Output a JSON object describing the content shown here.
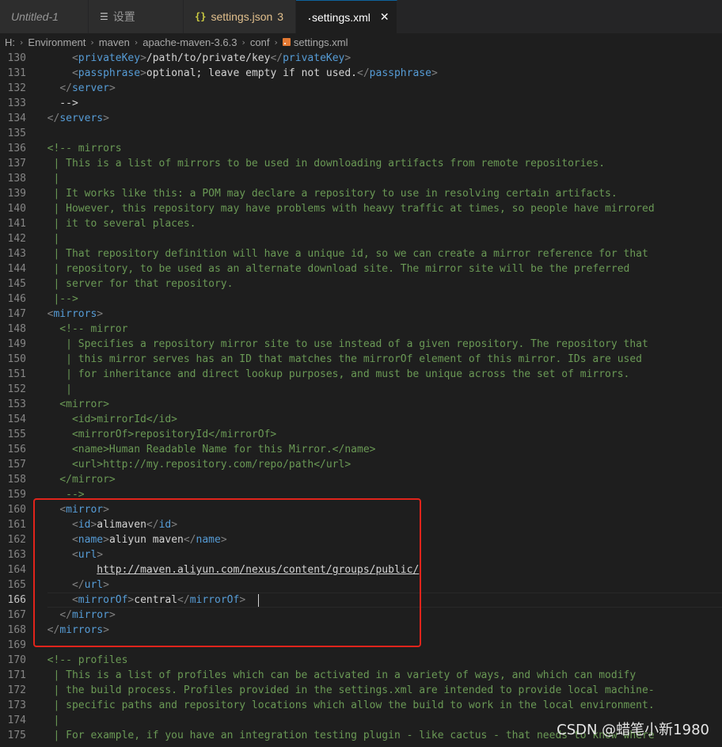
{
  "tabs": [
    {
      "label": "Untitled-1",
      "icon": "file-icon"
    },
    {
      "label": "设置",
      "icon": "settings-icon"
    },
    {
      "label": "settings.json",
      "badge": "3",
      "icon": "json-icon"
    },
    {
      "label": "settings.xml",
      "icon": "rss-icon",
      "active": true
    }
  ],
  "breadcrumb": [
    "H:",
    "Environment",
    "maven",
    "apache-maven-3.6.3",
    "conf",
    "settings.xml"
  ],
  "colors": {
    "highlight_box": "#e0241b",
    "active_tab_border": "#0e639c",
    "comment": "#6a9955",
    "tag": "#569cd6"
  },
  "editor": {
    "current_line": 166,
    "lines": [
      {
        "n": 130,
        "text": "      <privateKey>/path/to/private/key</privateKey>"
      },
      {
        "n": 131,
        "text": "      <passphrase>optional; leave empty if not used.</passphrase>"
      },
      {
        "n": 132,
        "text": "    </server>"
      },
      {
        "n": 133,
        "text": "    -->"
      },
      {
        "n": 134,
        "text": "  </servers>"
      },
      {
        "n": 135,
        "text": ""
      },
      {
        "n": 136,
        "text": "  <!-- mirrors"
      },
      {
        "n": 137,
        "text": "   | This is a list of mirrors to be used in downloading artifacts from remote repositories."
      },
      {
        "n": 138,
        "text": "   |"
      },
      {
        "n": 139,
        "text": "   | It works like this: a POM may declare a repository to use in resolving certain artifacts."
      },
      {
        "n": 140,
        "text": "   | However, this repository may have problems with heavy traffic at times, so people have mirrored"
      },
      {
        "n": 141,
        "text": "   | it to several places."
      },
      {
        "n": 142,
        "text": "   |"
      },
      {
        "n": 143,
        "text": "   | That repository definition will have a unique id, so we can create a mirror reference for that"
      },
      {
        "n": 144,
        "text": "   | repository, to be used as an alternate download site. The mirror site will be the preferred"
      },
      {
        "n": 145,
        "text": "   | server for that repository."
      },
      {
        "n": 146,
        "text": "   |-->"
      },
      {
        "n": 147,
        "text": "  <mirrors>"
      },
      {
        "n": 148,
        "text": "    <!-- mirror"
      },
      {
        "n": 149,
        "text": "     | Specifies a repository mirror site to use instead of a given repository. The repository that"
      },
      {
        "n": 150,
        "text": "     | this mirror serves has an ID that matches the mirrorOf element of this mirror. IDs are used"
      },
      {
        "n": 151,
        "text": "     | for inheritance and direct lookup purposes, and must be unique across the set of mirrors."
      },
      {
        "n": 152,
        "text": "     |"
      },
      {
        "n": 153,
        "text": "    <mirror>"
      },
      {
        "n": 154,
        "text": "      <id>mirrorId</id>"
      },
      {
        "n": 155,
        "text": "      <mirrorOf>repositoryId</mirrorOf>"
      },
      {
        "n": 156,
        "text": "      <name>Human Readable Name for this Mirror.</name>"
      },
      {
        "n": 157,
        "text": "      <url>http://my.repository.com/repo/path</url>"
      },
      {
        "n": 158,
        "text": "    </mirror>"
      },
      {
        "n": 159,
        "text": "     -->"
      },
      {
        "n": 160,
        "text": "    <mirror>"
      },
      {
        "n": 161,
        "text": "      <id>alimaven</id>"
      },
      {
        "n": 162,
        "text": "      <name>aliyun maven</name>"
      },
      {
        "n": 163,
        "text": "      <url>"
      },
      {
        "n": 164,
        "text": "          http://maven.aliyun.com/nexus/content/groups/public/"
      },
      {
        "n": 165,
        "text": "      </url>"
      },
      {
        "n": 166,
        "text": "      <mirrorOf>central</mirrorOf>  "
      },
      {
        "n": 167,
        "text": "    </mirror>"
      },
      {
        "n": 168,
        "text": "  </mirrors>"
      },
      {
        "n": 169,
        "text": ""
      },
      {
        "n": 170,
        "text": "  <!-- profiles"
      },
      {
        "n": 171,
        "text": "   | This is a list of profiles which can be activated in a variety of ways, and which can modify"
      },
      {
        "n": 172,
        "text": "   | the build process. Profiles provided in the settings.xml are intended to provide local machine-"
      },
      {
        "n": 173,
        "text": "   | specific paths and repository locations which allow the build to work in the local environment."
      },
      {
        "n": 174,
        "text": "   |"
      },
      {
        "n": 175,
        "text": "   | For example, if you have an integration testing plugin - like cactus - that needs to know where"
      }
    ]
  },
  "watermark": "CSDN @蜡笔小新1980"
}
